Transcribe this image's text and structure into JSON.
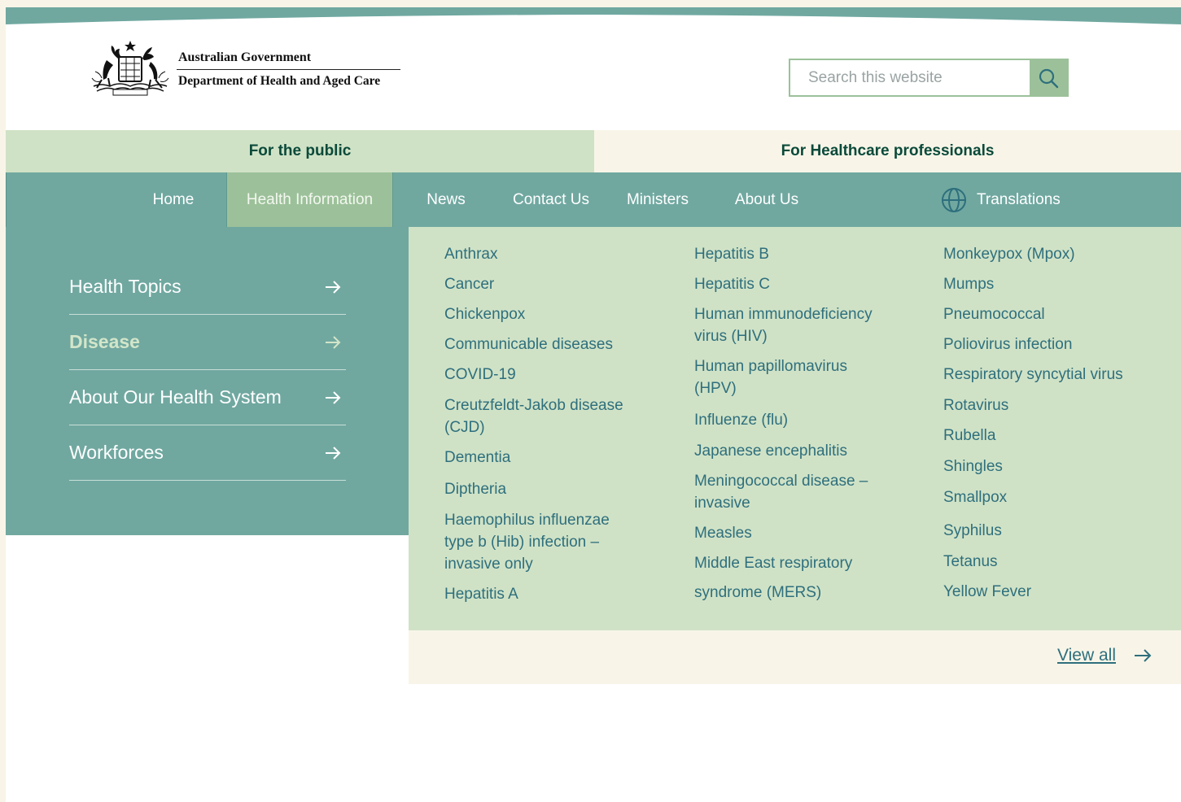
{
  "header": {
    "gov_name": "Australian Government",
    "dept_name": "Department of Health and Aged Care",
    "logo_icon": "coat-of-arms-icon",
    "search": {
      "placeholder": "Search this website",
      "value": "",
      "icon": "search-icon"
    }
  },
  "audience": {
    "public_label": "For the public",
    "professionals_label": "For Healthcare professionals",
    "selected": "For the public"
  },
  "nav": {
    "items": [
      {
        "label": "Home"
      },
      {
        "label": "Health Information"
      },
      {
        "label": "News"
      },
      {
        "label": "Contact Us"
      },
      {
        "label": "Ministers"
      },
      {
        "label": "About Us"
      }
    ],
    "active": "Health Information",
    "translations_label": "Translations",
    "translations_icon": "globe-icon"
  },
  "left_menu": {
    "items": [
      {
        "label": "Health Topics"
      },
      {
        "label": "Disease"
      },
      {
        "label": "About Our Health System"
      },
      {
        "label": "Workforces"
      }
    ],
    "active": "Disease",
    "arrow_icon": "arrow-right-icon"
  },
  "diseases": {
    "col1": [
      "Anthrax",
      "Cancer",
      "Chickenpox",
      "Communicable diseases",
      "COVID-19",
      "Creutzfeldt-Jakob disease (CJD)",
      "Dementia",
      "Diptheria",
      "Haemophilus influenzae type b (Hib) infection – invasive only",
      "Hepatitis A"
    ],
    "col2": [
      "Hepatitis B",
      "Hepatitis C",
      "Human immunodeficiency virus (HIV)",
      "Human papillomavirus (HPV)",
      "Influenze (flu)",
      "Japanese encephalitis",
      "Meningococcal disease – invasive",
      "Measles",
      "Middle East respiratory syndrome (MERS)"
    ],
    "col3": [
      "Monkeypox (Mpox)",
      "Mumps",
      "Pneumococcal",
      "Poliovirus infection",
      "Respiratory syncytial virus",
      "Rotavirus",
      "Rubella",
      "Shingles",
      "Smallpox",
      "Syphilus",
      "Tetanus",
      "Yellow Fever"
    ]
  },
  "view_all": {
    "label": "View all",
    "icon": "arrow-right-icon"
  },
  "colors": {
    "teal": "#70a8a0",
    "sage": "#9cc19a",
    "pale_green": "#d0e2c6",
    "cream": "#f8f5e8",
    "link": "#2e6f7d",
    "dark_green_text": "#0a4a3a"
  }
}
